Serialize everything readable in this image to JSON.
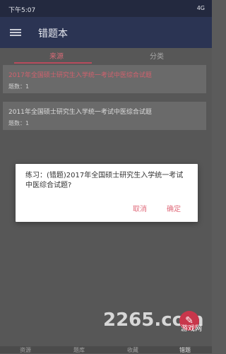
{
  "status": {
    "time": "下午5:07",
    "icons": "4G"
  },
  "app_bar": {
    "title": "错题本"
  },
  "tabs": [
    {
      "label": "来源"
    },
    {
      "label": "分类"
    }
  ],
  "cards": [
    {
      "title": "2017年全国硕士研究生入学统一考试中医综合试题",
      "count": "题数：1"
    },
    {
      "title": "2011年全国硕士研究生入学统一考试中医综合试题",
      "count": "题数：1"
    }
  ],
  "dialog": {
    "message": "练习：(错题)2017年全国硕士研究生入学统一考试中医综合试题?",
    "cancel": "取消",
    "confirm": "确定"
  },
  "watermark": {
    "main": "2265.com",
    "badge": "游戏网"
  },
  "bottom_nav": [
    {
      "label": "资源"
    },
    {
      "label": "题库"
    },
    {
      "label": "收藏"
    },
    {
      "label": "错题"
    }
  ]
}
